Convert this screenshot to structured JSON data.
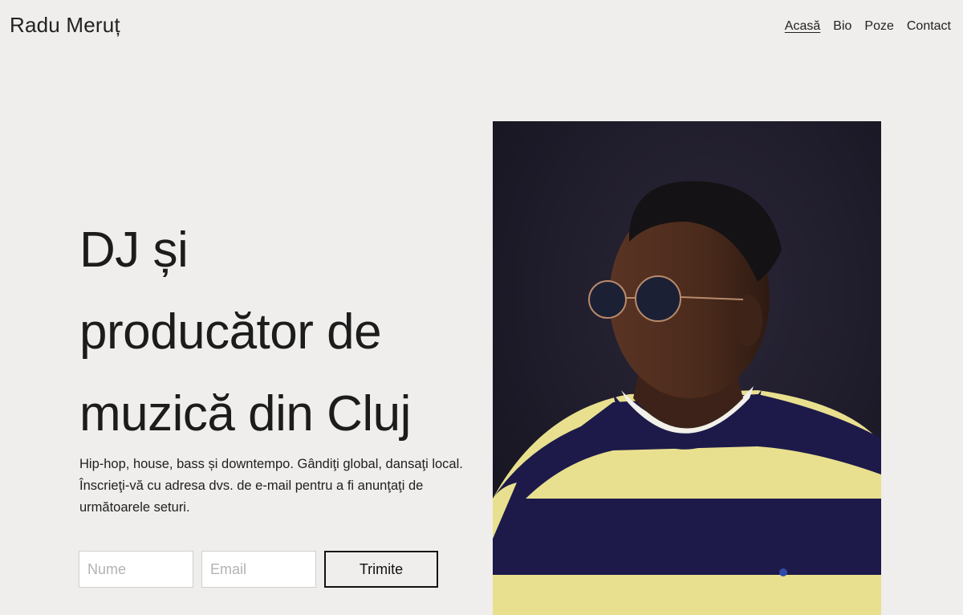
{
  "header": {
    "site_title": "Radu Meruț",
    "nav": [
      {
        "label": "Acasă",
        "active": true
      },
      {
        "label": "Bio",
        "active": false
      },
      {
        "label": "Poze",
        "active": false
      },
      {
        "label": "Contact",
        "active": false
      }
    ]
  },
  "hero": {
    "heading_lines": [
      "DJ și",
      "producător de",
      "muzică din Cluj"
    ],
    "description": "Hip-hop, house, bass și downtempo. Gândiţi global, dansaţi local. Înscrieţi-vă cu adresa dvs. de e-mail pentru a fi anunţaţi de următoarele seturi.",
    "form": {
      "name_placeholder": "Nume",
      "email_placeholder": "Email",
      "submit_label": "Trimite"
    }
  },
  "colors": {
    "background": "#efeeec",
    "text": "#1f1f1f",
    "photo_backdrop": "#1a1826",
    "sweater_yellow": "#e9e08f",
    "sweater_navy": "#1d1a4a"
  }
}
